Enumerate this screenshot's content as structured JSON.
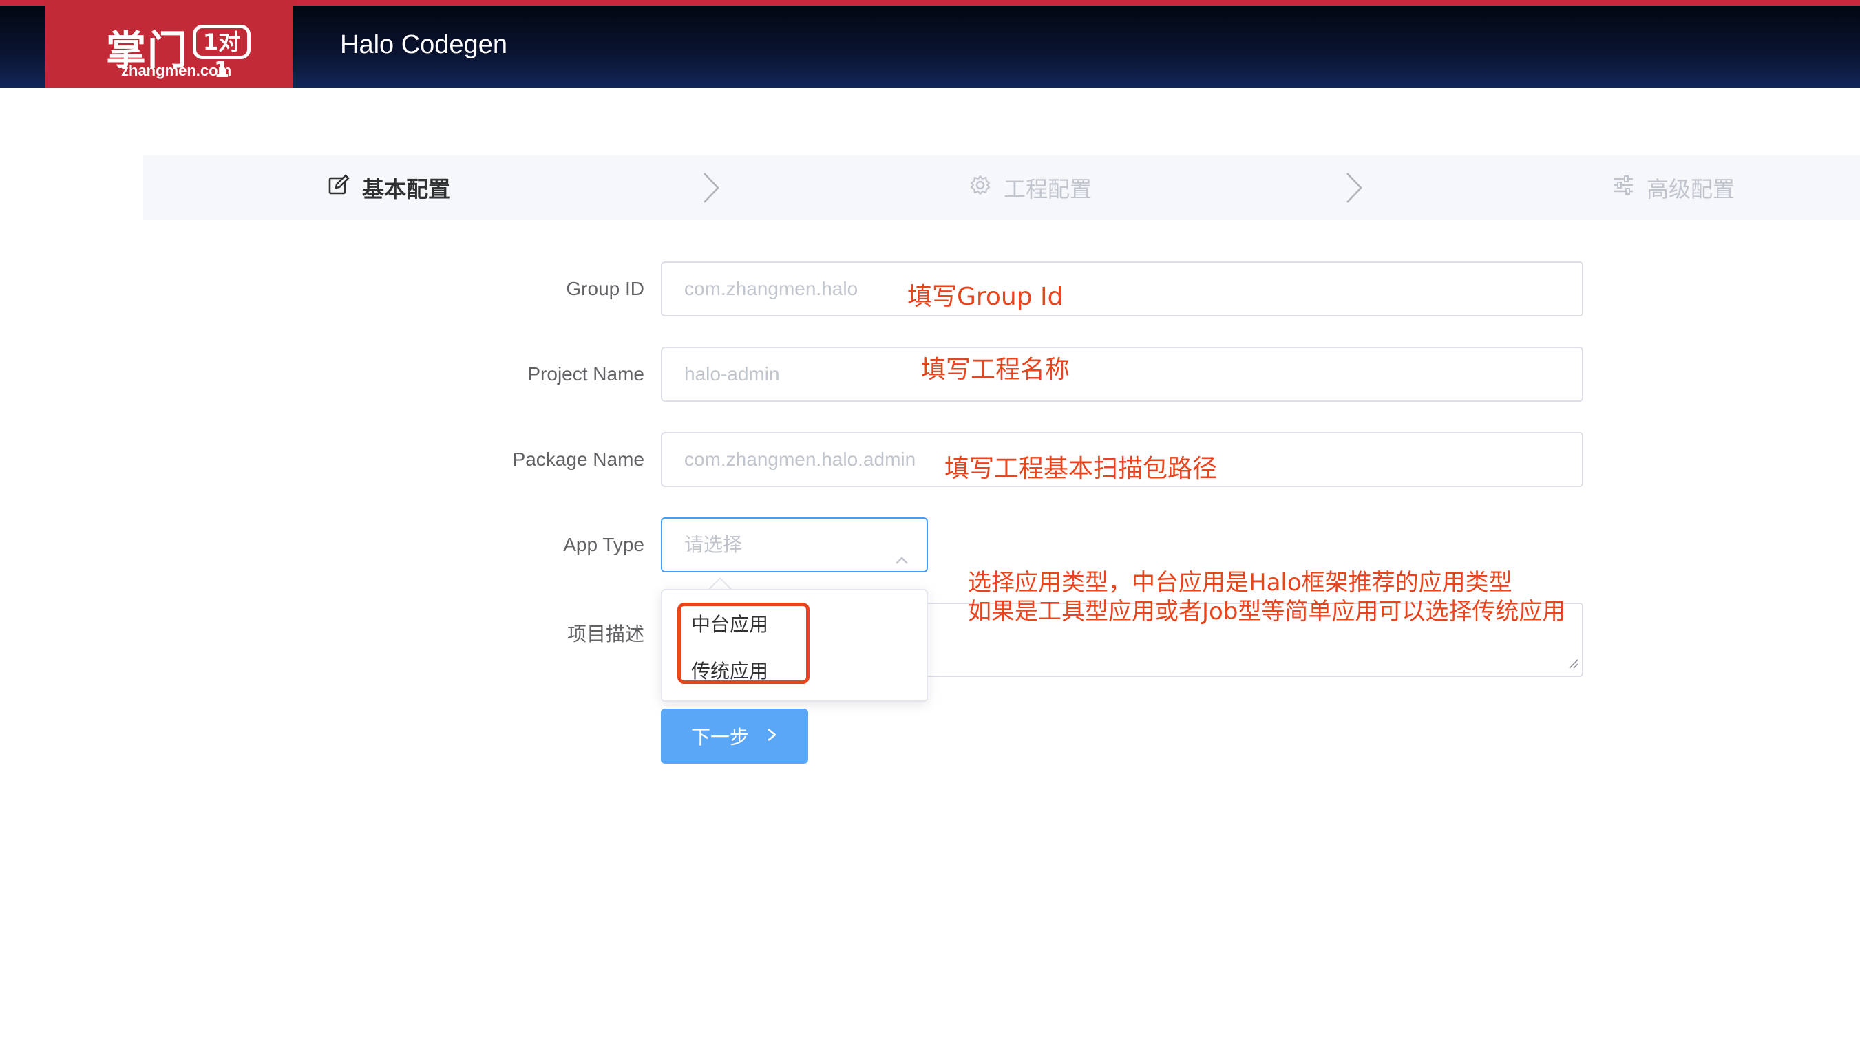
{
  "header": {
    "logo_main": "掌门",
    "logo_badge": "1对1",
    "logo_sub": "zhangmen.com",
    "app_title": "Halo Codegen"
  },
  "steps": [
    {
      "label": "基本配置",
      "icon": "edit-icon",
      "state": "active"
    },
    {
      "label": "工程配置",
      "icon": "gear-icon",
      "state": "inactive"
    },
    {
      "label": "高级配置",
      "icon": "sliders-icon",
      "state": "inactive"
    }
  ],
  "form": {
    "group_id": {
      "label": "Group ID",
      "placeholder": "com.zhangmen.halo"
    },
    "project_name": {
      "label": "Project Name",
      "placeholder": "halo-admin"
    },
    "package_name": {
      "label": "Package Name",
      "placeholder": "com.zhangmen.halo.admin"
    },
    "app_type": {
      "label": "App Type",
      "placeholder": "请选择",
      "options": [
        "中台应用",
        "传统应用"
      ]
    },
    "description": {
      "label": "项目描述"
    },
    "next_button": "下一步"
  },
  "annotations": {
    "group_id": "填写Group Id",
    "project_name": "填写工程名称",
    "package_name": "填写工程基本扫描包路径",
    "app_type_line1": "选择应用类型，中台应用是Halo框架推荐的应用类型",
    "app_type_line2": "如果是工具型应用或者Job型等简单应用可以选择传统应用"
  },
  "colors": {
    "brand_red": "#c12a36",
    "primary_blue": "#409eff",
    "annotation_red": "#e8451f"
  }
}
